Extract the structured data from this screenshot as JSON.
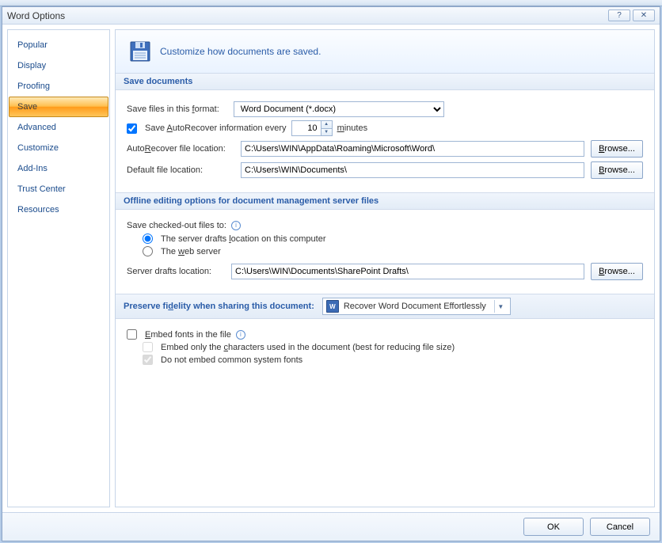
{
  "title": "Word Options",
  "titlebar": {
    "help": "?",
    "close": "✕"
  },
  "sidebar": {
    "items": [
      {
        "label": "Popular"
      },
      {
        "label": "Display"
      },
      {
        "label": "Proofing"
      },
      {
        "label": "Save"
      },
      {
        "label": "Advanced"
      },
      {
        "label": "Customize"
      },
      {
        "label": "Add-Ins"
      },
      {
        "label": "Trust Center"
      },
      {
        "label": "Resources"
      }
    ],
    "selected_index": 3
  },
  "hero": "Customize how documents are saved.",
  "save_docs": {
    "header": "Save documents",
    "format_label_pre": "Save files in this ",
    "format_underline": "f",
    "format_label_post": "ormat:",
    "format_value": "Word Document (*.docx)",
    "auto_check_pre": "Save ",
    "auto_check_underline": "A",
    "auto_check_post": "utoRecover information every",
    "auto_minutes": "10",
    "minutes_underline": "m",
    "minutes_post": "inutes",
    "auto_loc_pre": "Auto",
    "auto_loc_underline": "R",
    "auto_loc_post": "ecover file location:",
    "auto_loc_value": "C:\\Users\\WIN\\AppData\\Roaming\\Microsoft\\Word\\",
    "default_loc_label": "Default file location:",
    "default_loc_value": "C:\\Users\\WIN\\Documents\\",
    "browse_pre": "",
    "browse_underline": "B",
    "browse_post": "rowse..."
  },
  "offline": {
    "header": "Offline editing options for document management server files",
    "save_checked_label": "Save checked-out files to:",
    "radio1_pre": "The server drafts ",
    "radio1_underline": "l",
    "radio1_post": "ocation on this computer",
    "radio2_pre": "The ",
    "radio2_underline": "w",
    "radio2_post": "eb server",
    "server_loc_label": "Server drafts location:",
    "server_loc_value": "C:\\Users\\WIN\\Documents\\SharePoint Drafts\\",
    "browse2_underline": "B",
    "browse2_post": "rowse..."
  },
  "fidelity": {
    "header_pre": "Preserve fi",
    "header_underline": "d",
    "header_post": "elity when sharing this document:",
    "doc_name": "Recover Word Document Effortlessly",
    "embed_underline": "E",
    "embed_post": "mbed fonts in the file",
    "sub1_pre": "Embed only the ",
    "sub1_underline": "c",
    "sub1_post": "haracters used in the document (best for reducing file size)",
    "sub2": "Do not embed common system fonts"
  },
  "footer": {
    "ok": "OK",
    "cancel": "Cancel"
  }
}
